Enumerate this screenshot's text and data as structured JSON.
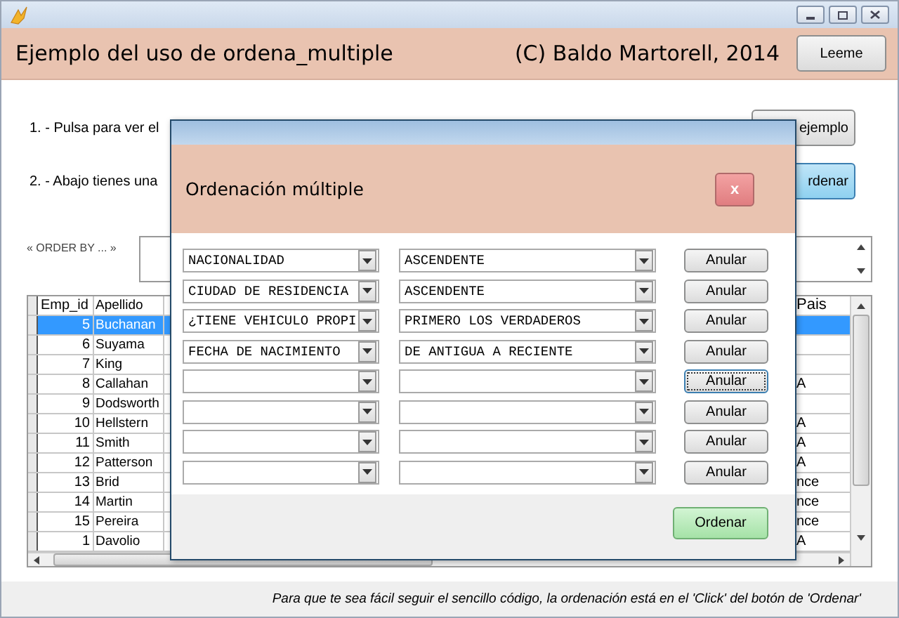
{
  "header": {
    "title": "Ejemplo del uso de ordena_multiple",
    "copyright": "(C) Baldo Martorell, 2014",
    "button": "Leeme"
  },
  "steps": [
    {
      "text": "1. - Pulsa para ver el",
      "button": "ejemplo",
      "kind": "plain"
    },
    {
      "text": "2. - Abajo tienes una",
      "button": "rdenar",
      "kind": "primary"
    }
  ],
  "order_by": {
    "label": "« ORDER BY ... »"
  },
  "grid": {
    "headers": {
      "emp_id": "Emp_id",
      "apellido": "Apellido",
      "pais": "Pais"
    },
    "rows": [
      {
        "emp_id": "5",
        "apellido": "Buchanan",
        "selected": true
      },
      {
        "emp_id": "6",
        "apellido": "Suyama",
        "selected": false
      },
      {
        "emp_id": "7",
        "apellido": "King",
        "selected": false
      },
      {
        "emp_id": "8",
        "apellido": "Callahan",
        "pais": "A",
        "selected": false
      },
      {
        "emp_id": "9",
        "apellido": "Dodsworth",
        "selected": false
      },
      {
        "emp_id": "10",
        "apellido": "Hellstern",
        "pais": "A",
        "selected": false
      },
      {
        "emp_id": "11",
        "apellido": "Smith",
        "pais": "A",
        "selected": false
      },
      {
        "emp_id": "12",
        "apellido": "Patterson",
        "pais": "A",
        "selected": false
      },
      {
        "emp_id": "13",
        "apellido": "Brid",
        "pais": "nce",
        "selected": false
      },
      {
        "emp_id": "14",
        "apellido": "Martin",
        "pais": "nce",
        "selected": false
      },
      {
        "emp_id": "15",
        "apellido": "Pereira",
        "pais": "nce",
        "selected": false
      },
      {
        "emp_id": "1",
        "apellido": "Davolio",
        "pais": "A",
        "selected": false
      }
    ]
  },
  "footer": "Para que te sea fácil seguir el sencillo código,  la ordenación está en el 'Click' del botón de 'Ordenar'",
  "dialog": {
    "title": "Ordenación múltiple",
    "close": "x",
    "submit": "Ordenar",
    "rows": [
      {
        "field": "NACIONALIDAD",
        "order": "ASCENDENTE",
        "button": "Anular",
        "focused": false
      },
      {
        "field": "CIUDAD DE RESIDENCIA",
        "order": "ASCENDENTE",
        "button": "Anular",
        "focused": false
      },
      {
        "field": "¿TIENE VEHICULO PROPI",
        "order": "PRIMERO LOS VERDADEROS",
        "button": "Anular",
        "focused": false
      },
      {
        "field": "FECHA DE NACIMIENTO",
        "order": "DE ANTIGUA A RECIENTE",
        "button": "Anular",
        "focused": false
      },
      {
        "button": "Anular",
        "focused": true
      },
      {
        "button": "Anular",
        "focused": false
      },
      {
        "button": "Anular",
        "focused": false
      },
      {
        "button": "Anular",
        "focused": false
      }
    ]
  }
}
